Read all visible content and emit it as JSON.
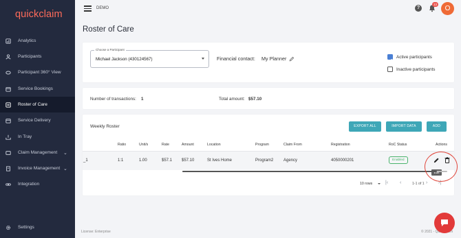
{
  "app": {
    "logo": "quickclaim",
    "env": "DEMO"
  },
  "header": {
    "notifications_count": "13",
    "avatar_initial": "O"
  },
  "sidebar": {
    "items": [
      {
        "label": "Analytics",
        "icon": "analytics-icon"
      },
      {
        "label": "Participants",
        "icon": "participants-icon"
      },
      {
        "label": "Participant 360° View",
        "icon": "view-360-icon"
      },
      {
        "label": "Service Bookings",
        "icon": "calendar-icon"
      },
      {
        "label": "Roster of Care",
        "icon": "roster-icon",
        "active": true
      },
      {
        "label": "Service Delivery",
        "icon": "calendar-icon"
      },
      {
        "label": "In Tray",
        "icon": "tray-icon"
      },
      {
        "label": "Claim Management",
        "icon": "claim-icon",
        "expandable": true
      },
      {
        "label": "Invoice Management",
        "icon": "invoice-icon",
        "expandable": true
      },
      {
        "label": "Integration",
        "icon": "link-icon"
      }
    ],
    "settings_label": "Settings"
  },
  "page": {
    "title": "Roster of Care"
  },
  "filters": {
    "participant_label": "Choose a Participant",
    "participant_value": "Michael Jackson (430124567)",
    "financial_contact_label": "Financial contact:",
    "financial_contact_value": "My Planner",
    "active_participants_label": "Active participants",
    "active_participants_checked": true,
    "inactive_participants_label": "Inactive participants",
    "inactive_participants_checked": false
  },
  "summary": {
    "transactions_label": "Number of transactions:",
    "transactions_value": "1",
    "amount_label": "Total amount:",
    "amount_value": "$57.10"
  },
  "roster": {
    "title": "Weekly Roster",
    "buttons": {
      "export": "EXPORT ALL",
      "import": "IMPORT DATA",
      "add": "ADD"
    },
    "columns": [
      "Ratio",
      "Unit/s",
      "Rate",
      "Amount",
      "Location",
      "Program",
      "Claim From",
      "Registration",
      "RoC Status",
      "Actions"
    ],
    "row": {
      "first": "_1",
      "ratio": "1:1",
      "units": "1.00",
      "rate": "$57.1",
      "amount": "$57.10",
      "location": "St Ives Home",
      "program": "Program2",
      "claim_from": "Agency",
      "registration": "4050000201",
      "status": "Enabled"
    },
    "tooltip": "Edit",
    "pagination": {
      "rows": "10 rows",
      "info": "1-1 of 1"
    }
  },
  "footer": {
    "license": "License: Enterprise",
    "copyright": "© 2021 - QuickClaim"
  },
  "colors": {
    "accent": "#3ea7b7",
    "sidebar": "#232a3e",
    "brand": "#ff6b5a",
    "status_enabled": "#49b36b"
  }
}
